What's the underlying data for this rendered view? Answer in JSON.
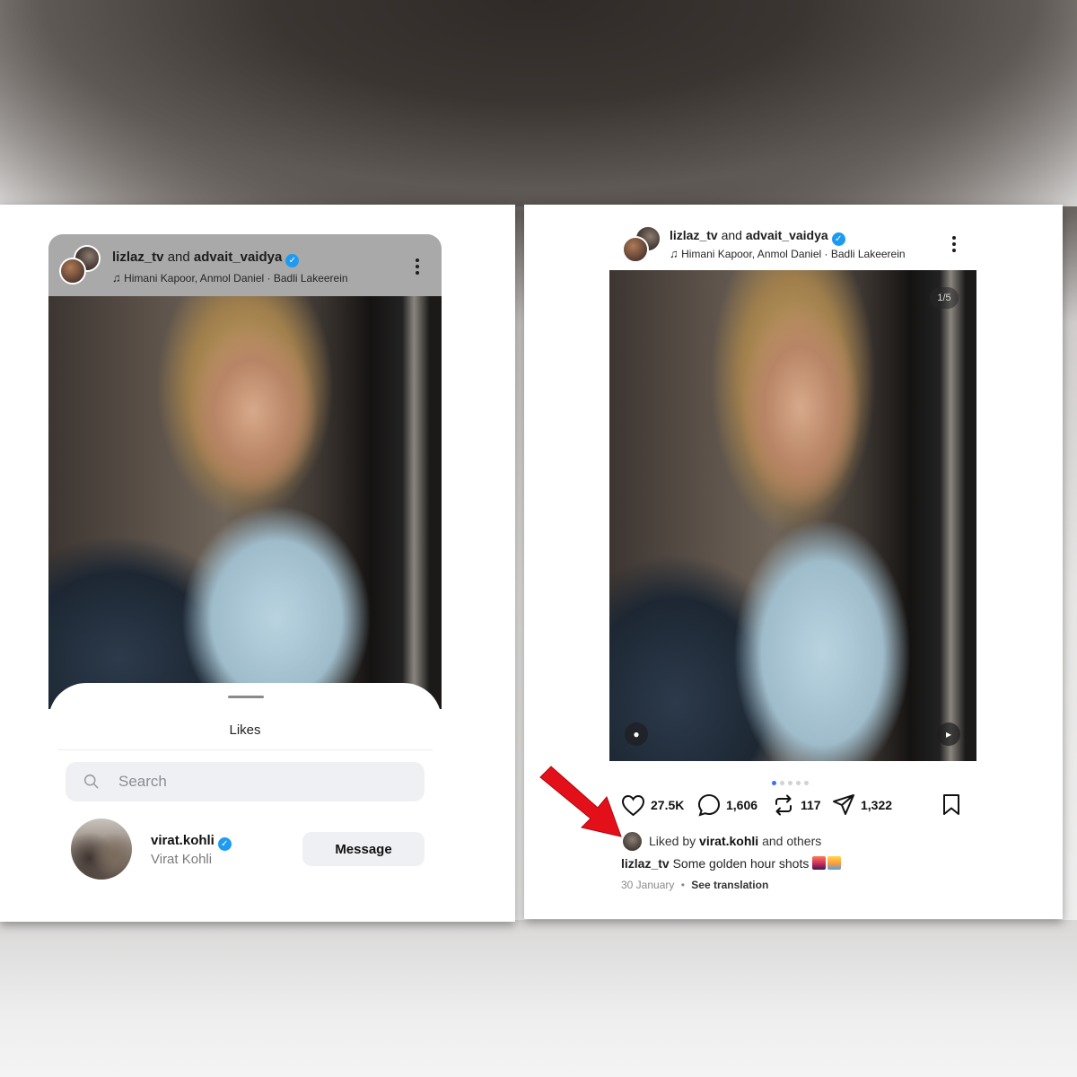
{
  "post": {
    "author_primary": "lizlaz_tv",
    "joiner": "and",
    "author_collab": "advait_vaidya",
    "verified_mark": "✓",
    "music": "Himani Kapoor, Anmol Daniel · Badli Lakeerein",
    "image_counter": "1/5",
    "caption_author": "lizlaz_tv",
    "caption_text": "Some golden hour shots",
    "date": "30 January",
    "separator": "•",
    "see_translation": "See translation"
  },
  "stats": {
    "likes": "27.5K",
    "comments": "1,606",
    "reposts": "117",
    "shares": "1,322"
  },
  "liked_by": {
    "prefix": "Liked by",
    "user": "virat.kohli",
    "suffix": "and others"
  },
  "likes_sheet": {
    "title": "Likes",
    "search_placeholder": "Search",
    "user": {
      "handle": "virat.kohli",
      "name": "Virat Kohli",
      "action_label": "Message"
    }
  },
  "pager": {
    "total": 5,
    "active_index": 0
  },
  "colors": {
    "verified": "#1d9bf0",
    "pager_active": "#3b6ff5",
    "arrow": "#e3101a"
  },
  "icons": [
    "music-note-icon",
    "more-options-icon",
    "search-icon",
    "heart-icon",
    "comment-icon",
    "repost-icon",
    "share-icon",
    "bookmark-icon",
    "user-tag-icon",
    "volume-icon"
  ]
}
